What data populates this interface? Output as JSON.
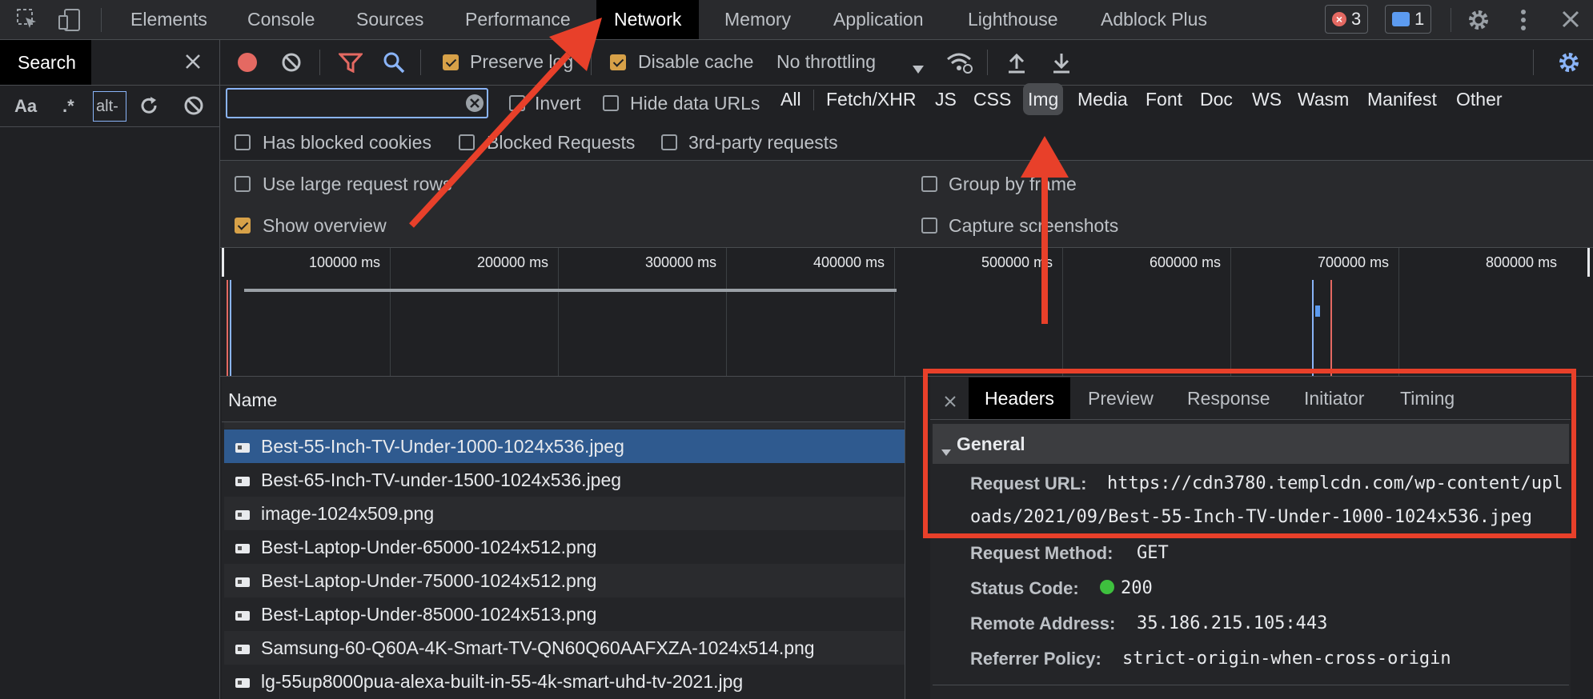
{
  "topbar": {
    "tabs": [
      "Elements",
      "Console",
      "Sources",
      "Performance",
      "Network",
      "Memory",
      "Application",
      "Lighthouse",
      "Adblock Plus"
    ],
    "active_tab": "Network",
    "error_count": "3",
    "message_count": "1"
  },
  "search_pane": {
    "title": "Search",
    "match_case": "Aa",
    "regex": ".*",
    "query": "alt-"
  },
  "toolbar": {
    "preserve_log": "Preserve log",
    "disable_cache": "Disable cache",
    "throttling": "No throttling"
  },
  "filter_bar": {
    "invert": "Invert",
    "hide_data_urls": "Hide data URLs",
    "types": [
      "All",
      "Fetch/XHR",
      "JS",
      "CSS",
      "Img",
      "Media",
      "Font",
      "Doc",
      "WS",
      "Wasm",
      "Manifest",
      "Other"
    ],
    "selected_type": "Img",
    "has_blocked_cookies": "Has blocked cookies",
    "blocked_requests": "Blocked Requests",
    "third_party": "3rd-party requests"
  },
  "settings": {
    "large_rows": "Use large request rows",
    "show_overview": "Show overview",
    "group_by_frame": "Group by frame",
    "capture_screenshots": "Capture screenshots"
  },
  "overview": {
    "ticks": [
      "100000 ms",
      "200000 ms",
      "300000 ms",
      "400000 ms",
      "500000 ms",
      "600000 ms",
      "700000 ms",
      "800000 ms"
    ]
  },
  "requests": {
    "column_name": "Name",
    "rows": [
      "Best-55-Inch-TV-Under-1000-1024x536.jpeg",
      "Best-65-Inch-TV-under-1500-1024x536.jpeg",
      "image-1024x509.png",
      "Best-Laptop-Under-65000-1024x512.png",
      "Best-Laptop-Under-75000-1024x512.png",
      "Best-Laptop-Under-85000-1024x513.png",
      "Samsung-60-Q60A-4K-Smart-TV-QN60Q60AAFXZA-1024x514.png",
      "lg-55up8000pua-alexa-built-in-55-4k-smart-uhd-tv-2021.jpg"
    ],
    "selected_index": 0
  },
  "details": {
    "tabs": [
      "Headers",
      "Preview",
      "Response",
      "Initiator",
      "Timing"
    ],
    "active_tab": "Headers",
    "section": "General",
    "request_url_label": "Request URL:",
    "request_url_line1": "https://cdn3780.templcdn.com/wp-content/upl",
    "request_url_line2": "oads/2021/09/Best-55-Inch-TV-Under-1000-1024x536.jpeg",
    "method_label": "Request Method:",
    "method": "GET",
    "status_label": "Status Code:",
    "status": "200",
    "remote_label": "Remote Address:",
    "remote": "35.186.215.105:443",
    "referrer_label": "Referrer Policy:",
    "referrer": "strict-origin-when-cross-origin"
  },
  "colors": {
    "annotation": "#e8402a",
    "selected_row": "#2f5a8f",
    "status_ok": "#3ec03e"
  }
}
